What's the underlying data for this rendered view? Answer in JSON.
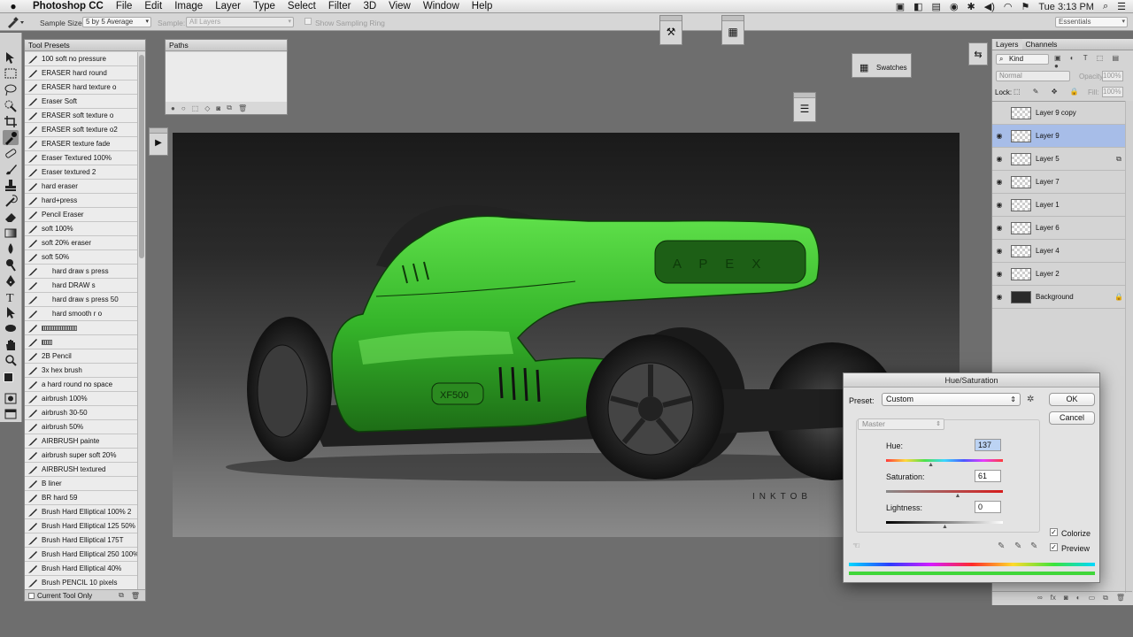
{
  "menubar": {
    "items": [
      "Photoshop CC",
      "File",
      "Edit",
      "Image",
      "Layer",
      "Type",
      "Select",
      "Filter",
      "3D",
      "View",
      "Window",
      "Help"
    ],
    "clock": "Tue 3:13 PM"
  },
  "options": {
    "sample_size_label": "Sample Size:",
    "sample_size_value": "5 by 5 Average",
    "sample_label": "Sample:",
    "sample_value": "All Layers",
    "show_sampling_ring": "Show Sampling Ring",
    "workspace": "Essentials"
  },
  "tool_presets": {
    "title": "Tool Presets",
    "items": [
      {
        "label": "100 soft no pressure",
        "indent": false
      },
      {
        "label": "ERASER hard round",
        "indent": false
      },
      {
        "label": "ERASER hard texture o",
        "indent": false
      },
      {
        "label": "Eraser Soft",
        "indent": false
      },
      {
        "label": "ERASER soft texture o",
        "indent": false
      },
      {
        "label": "ERASER soft texture o2",
        "indent": false
      },
      {
        "label": "ERASER texture fade",
        "indent": false
      },
      {
        "label": "Eraser Textured 100%",
        "indent": false
      },
      {
        "label": "Eraser textured 2",
        "indent": false
      },
      {
        "label": "hard eraser",
        "indent": false
      },
      {
        "label": "hard+press",
        "indent": false
      },
      {
        "label": "Pencil Eraser",
        "indent": false
      },
      {
        "label": "soft 100%",
        "indent": false
      },
      {
        "label": "soft 20% eraser",
        "indent": false
      },
      {
        "label": "soft 50%",
        "indent": false
      },
      {
        "label": "hard draw s press",
        "indent": true
      },
      {
        "label": "hard DRAW s",
        "indent": true
      },
      {
        "label": "hard draw s press 50",
        "indent": true
      },
      {
        "label": "hard smooth r o",
        "indent": true
      },
      {
        "label": "",
        "indent": false,
        "pattern": 40
      },
      {
        "label": "",
        "indent": false,
        "pattern": 12
      },
      {
        "label": "2B Pencil",
        "indent": false
      },
      {
        "label": "3x hex brush",
        "indent": false
      },
      {
        "label": "a hard round no space",
        "indent": false
      },
      {
        "label": "airbrush 100%",
        "indent": false
      },
      {
        "label": "airbrush 30-50",
        "indent": false
      },
      {
        "label": "airbrush 50%",
        "indent": false
      },
      {
        "label": "AIRBRUSH painte",
        "indent": false
      },
      {
        "label": "airbrush super soft 20%",
        "indent": false
      },
      {
        "label": "AIRBRUSH textured",
        "indent": false
      },
      {
        "label": "B liner",
        "indent": false
      },
      {
        "label": "BR hard 59",
        "indent": false
      },
      {
        "label": "Brush Hard Elliptical 100% 2",
        "indent": false
      },
      {
        "label": "Brush Hard Elliptical 125 50%",
        "indent": false
      },
      {
        "label": "Brush Hard Elliptical 175T",
        "indent": false
      },
      {
        "label": "Brush Hard Elliptical 250 100%",
        "indent": false
      },
      {
        "label": "Brush Hard Elliptical 40%",
        "indent": false
      },
      {
        "label": "Brush PENCIL 10 pixels",
        "indent": false
      }
    ],
    "current_tool_only": "Current Tool Only"
  },
  "paths": {
    "title": "Paths"
  },
  "swatches": {
    "label": "Swatches"
  },
  "layers_panel": {
    "tabs": [
      "Layers",
      "Channels"
    ],
    "kind": "Kind",
    "blend_mode": "Normal",
    "opacity_label": "Opacity:",
    "opacity_value": "100%",
    "lock_label": "Lock:",
    "fill_label": "Fill:",
    "fill_value": "100%",
    "layers": [
      {
        "name": "Layer 9 copy",
        "visible": false,
        "selected": false,
        "badge": ""
      },
      {
        "name": "Layer 9",
        "visible": true,
        "selected": true,
        "badge": ""
      },
      {
        "name": "Layer 5",
        "visible": true,
        "selected": false,
        "badge": "⧉"
      },
      {
        "name": "Layer 7",
        "visible": true,
        "selected": false,
        "badge": ""
      },
      {
        "name": "Layer 1",
        "visible": true,
        "selected": false,
        "badge": ""
      },
      {
        "name": "Layer 6",
        "visible": true,
        "selected": false,
        "badge": ""
      },
      {
        "name": "Layer 4",
        "visible": true,
        "selected": false,
        "badge": ""
      },
      {
        "name": "Layer 2",
        "visible": true,
        "selected": false,
        "badge": ""
      },
      {
        "name": "Background",
        "visible": true,
        "selected": false,
        "badge": "🔒"
      }
    ]
  },
  "hue_saturation": {
    "title": "Hue/Saturation",
    "preset_label": "Preset:",
    "preset_value": "Custom",
    "channel": "Master",
    "hue_label": "Hue:",
    "hue_value": "137",
    "saturation_label": "Saturation:",
    "saturation_value": "61",
    "lightness_label": "Lightness:",
    "lightness_value": "0",
    "ok": "OK",
    "cancel": "Cancel",
    "colorize": "Colorize",
    "preview": "Preview",
    "colorize_checked": true,
    "preview_checked": true,
    "hue_slider": 0.38,
    "saturation_slider": 0.61,
    "lightness_slider": 0.5
  },
  "canvas": {
    "badge_text": "XF500",
    "nose_text": "A P E X",
    "signature": "INKTOB",
    "body_color": "#35b52a"
  }
}
